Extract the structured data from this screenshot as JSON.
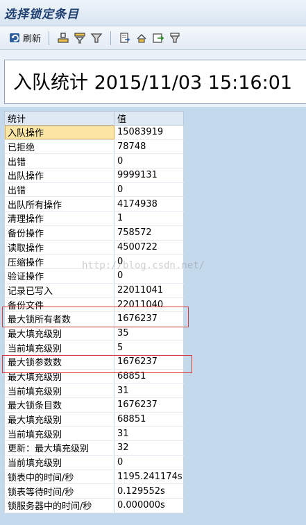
{
  "window": {
    "title": "选择锁定条目"
  },
  "toolbar": {
    "refresh_label": "刷新",
    "icons": [
      "refresh-icon",
      "align-icon",
      "filter-set-icon",
      "filter-icon",
      "export-icon",
      "layout-icon",
      "save-icon",
      "print-icon"
    ]
  },
  "header": {
    "title": "入队统计 2015/11/03 15:16:01"
  },
  "table": {
    "columns": [
      "统计",
      "值"
    ],
    "selected_row": 0,
    "rows": [
      [
        "入队操作",
        "15083919"
      ],
      [
        "已拒绝",
        "78748"
      ],
      [
        "出错",
        "0"
      ],
      [
        "出队操作",
        "9999131"
      ],
      [
        "出错",
        "0"
      ],
      [
        "出队所有操作",
        "4174938"
      ],
      [
        "清理操作",
        "1"
      ],
      [
        "备份操作",
        "758572"
      ],
      [
        "读取操作",
        "4500722"
      ],
      [
        "压缩操作",
        "0"
      ],
      [
        "验证操作",
        "0"
      ],
      [
        "记录已写入",
        "22011041"
      ],
      [
        "备份文件",
        "22011040"
      ],
      [
        "最大锁所有者数",
        "1676237"
      ],
      [
        "最大填充级别",
        "35"
      ],
      [
        "当前填充级别",
        "5"
      ],
      [
        "最大锁参数数",
        "1676237"
      ],
      [
        "最大填充级别",
        "68851"
      ],
      [
        "当前填充级别",
        "31"
      ],
      [
        "最大锁条目数",
        "1676237"
      ],
      [
        "最大填充级别",
        "68851"
      ],
      [
        "当前填充级别",
        "31"
      ],
      [
        "更新：最大填充级别",
        "32"
      ],
      [
        "当前填充级别",
        "0"
      ],
      [
        "锁表中的时间/秒",
        "1195.241174s"
      ],
      [
        "锁表等待时间/秒",
        "0.129552s"
      ],
      [
        "锁服务器中的时间/秒",
        "0.000000s"
      ]
    ]
  },
  "watermark": "http://blog.csdn.net/"
}
